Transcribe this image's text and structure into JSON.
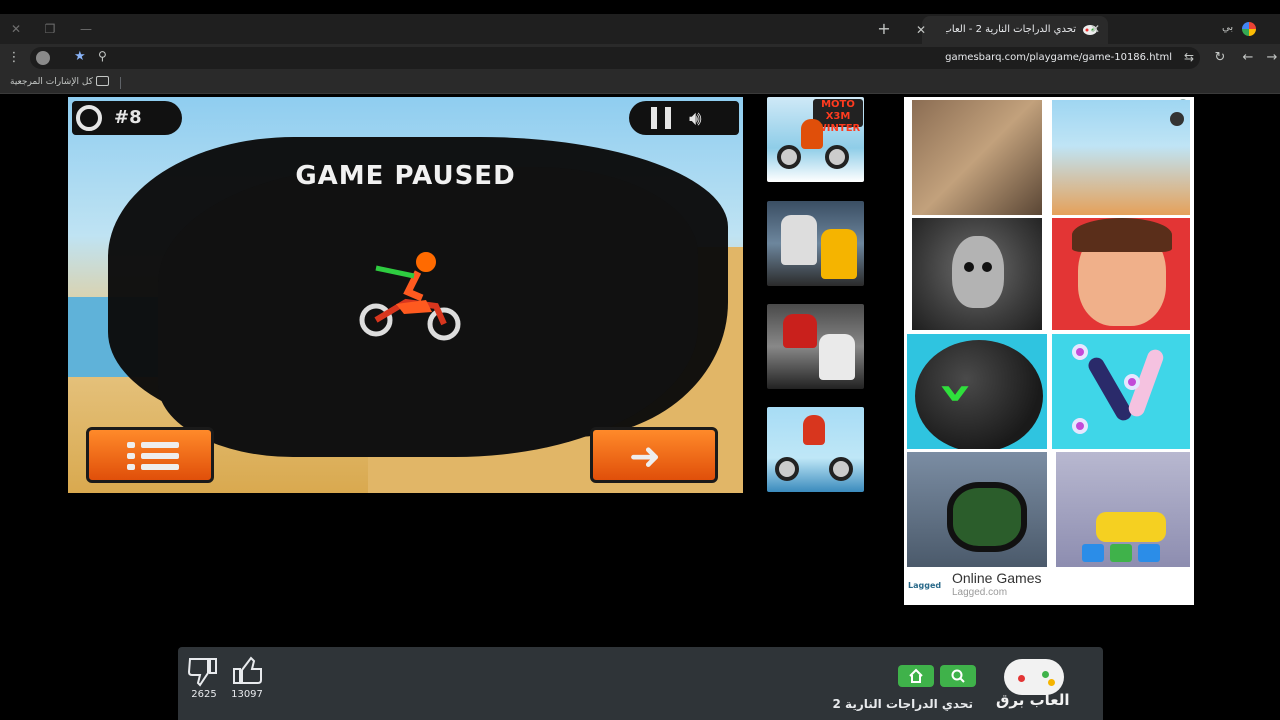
{
  "browser": {
    "tab_title": "تحدي الدراجات النارية 2 - العاب برق",
    "tab_right_label": "بي",
    "url": "gamesbarq.com/playgame/game-10186.html",
    "bookmarks_label": "كل الإشارات المرجعية"
  },
  "game": {
    "status_title": "GAME PAUSED",
    "level_label": "#8"
  },
  "thumbnails": [
    {
      "logo": "MOTO X3M WINTER"
    },
    {
      "logo": ""
    },
    {
      "logo": ""
    },
    {
      "logo": ""
    }
  ],
  "ad": {
    "title": "Online Games",
    "subtitle": "Lagged.com",
    "brand_logo": "Lagged"
  },
  "bottom_bar": {
    "dislikes": "2625",
    "likes": "13097",
    "game_title": "تحدي الدراجات النارية 2",
    "site_logo_text": "العاب برق"
  },
  "icons": {
    "home": "home-icon",
    "search": "search-icon",
    "like": "thumbs-up-icon",
    "dislike": "thumbs-down-icon"
  },
  "colors": {
    "accent_green": "#3fb24a",
    "button_orange": "#ff8a2a"
  }
}
